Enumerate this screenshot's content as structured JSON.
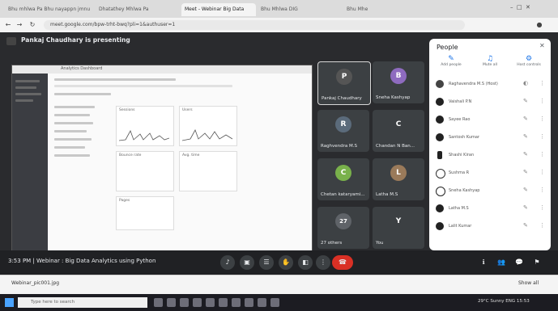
{
  "browser": {
    "tabs": [
      {
        "label": "Bhu mhlwa Pa Bhu nayappn jmnu"
      },
      {
        "label": "Dhatathey Mhlwa Pa"
      },
      {
        "label": "Meet - Webinar Big Data"
      },
      {
        "label": "Bhu Mhlwa DIG"
      },
      {
        "label": "Bhu Mhe"
      }
    ],
    "url": "meet.google.com/bpw-trht-bwq?pli=1&authuser=1"
  },
  "meet": {
    "presenter": "Pankaj Chaudhary is presenting",
    "shared_window": {
      "title": "Analytics Dashboard",
      "cards": [
        {
          "title": "Sessions"
        },
        {
          "title": "Users"
        },
        {
          "title": "Bounce rate"
        },
        {
          "title": "Avg. time"
        },
        {
          "title": "Pages"
        }
      ]
    },
    "tiles": [
      {
        "name": "Pankaj Chaudhary",
        "initial": "P",
        "color": "#3c4043"
      },
      {
        "name": "Sneha Kashyap",
        "initial": "B",
        "color": "#8e6bbf"
      },
      {
        "name": "Raghvendra M.S",
        "initial": "R",
        "color": "#5b6b7b"
      },
      {
        "name": "Chandan N Ban...",
        "initial": "C",
        "color": "#3c4043"
      },
      {
        "name": "Chetan kataryami...",
        "initial": "C",
        "color": "#79b14b"
      },
      {
        "name": "Latha M.S",
        "initial": "L",
        "color": "#9a7a5a"
      },
      {
        "name": "27 others",
        "initial": "27",
        "color": "#5f6368"
      },
      {
        "name": "You",
        "initial": "Y",
        "color": "#3c4043"
      }
    ],
    "meeting_info": "3:53 PM  |  Webinar : Big Data Analytics using Python"
  },
  "people_panel": {
    "title": "People",
    "close": "✕",
    "actions": [
      {
        "icon": "✎",
        "label": "Add people"
      },
      {
        "icon": "♫",
        "label": "Mute all"
      },
      {
        "icon": "⚙",
        "label": "Host controls"
      }
    ],
    "people": [
      {
        "name": "Raghavendra M.S (Host)",
        "color": "#444"
      },
      {
        "name": "Vaishali P.N",
        "color": "#222"
      },
      {
        "name": "Sayee Rao",
        "color": "#222"
      },
      {
        "name": "Santosh Kumar",
        "color": "#222"
      },
      {
        "name": "Shashi Kiran",
        "color": "#222"
      },
      {
        "name": "Sushma R",
        "color": "#222"
      },
      {
        "name": "Sneha Kashyap",
        "color": "#222"
      },
      {
        "name": "Latha M.S",
        "color": "#222"
      },
      {
        "name": "Lalit Kumar",
        "color": "#222"
      }
    ]
  },
  "controls": [
    {
      "icon": "♪"
    },
    {
      "icon": "▣"
    },
    {
      "icon": "☰"
    },
    {
      "icon": "✋"
    },
    {
      "icon": "◧"
    },
    {
      "icon": "⋮"
    },
    {
      "icon": "☎"
    }
  ],
  "right_controls": [
    {
      "icon": "ℹ"
    },
    {
      "icon": "👥"
    },
    {
      "icon": "💬"
    },
    {
      "icon": "⚑"
    }
  ],
  "download": {
    "file": "Webinar_pic001.jpg",
    "show_all": "Show all"
  },
  "taskbar": {
    "search_placeholder": "Type here to search",
    "tray": "29°C Sunny  ENG  15:53"
  }
}
